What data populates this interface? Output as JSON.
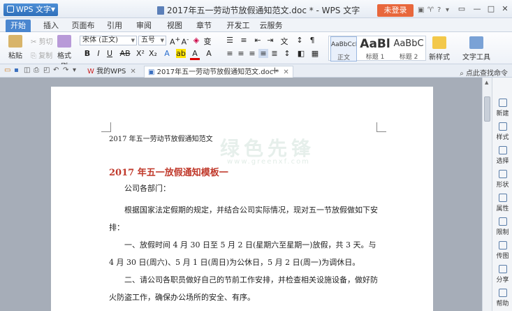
{
  "app": {
    "menu_label": "WPS 文字",
    "title": "2017年五一劳动节放假通知范文.doc * - WPS 文字",
    "login_label": "未登录"
  },
  "tabs": [
    "开始",
    "插入",
    "页面布局",
    "引用",
    "审阅",
    "视图",
    "章节",
    "开发工具",
    "云服务"
  ],
  "ribbon": {
    "paste": "粘贴",
    "cut": "剪切",
    "copy": "复制",
    "format_painter": "格式刷",
    "font_name": "宋体 (正文)",
    "font_size": "五号",
    "styles": [
      {
        "sample": "AaBbCcDd",
        "name": "正文"
      },
      {
        "sample": "AaBl",
        "name": "标题 1"
      },
      {
        "sample": "AaBbC",
        "name": "标题 2"
      }
    ],
    "new_style": "新样式",
    "text_tools": "文字工具"
  },
  "doc_tabs": [
    {
      "label": "我的WPS"
    },
    {
      "label": "2017年五一劳动节放假通知范文.doc *"
    }
  ],
  "find_label": "点此查找命令",
  "document": {
    "header": "2017 年五一劳动节放假通知范文",
    "watermark": "绿色先锋",
    "watermark_sub": "www.greenxf.com",
    "headline": "2017 年五一放假通知模板一",
    "salutation": "公司各部门：",
    "para1": "根据国家法定假期的规定，并结合公司实际情况，现对五一节放假做如下安排：",
    "para2": "一、放假时间 4 月 30 日至 5 月 2 日(星期六至星期一)放假，共 3 天。与 4 月 30 日(周六)、5 月 1 日(周日)为公休日，5 月 2 日(周一)为调休日。",
    "para3": "二、请公司各职员做好自己的节前工作安排，并检查相关设施设备，做好防火防盗工作，确保办公场所的安全、有序。"
  },
  "side_panel": [
    "新建",
    "样式",
    "选择",
    "形状",
    "属性",
    "限制",
    "传图",
    "分享",
    "帮助"
  ]
}
